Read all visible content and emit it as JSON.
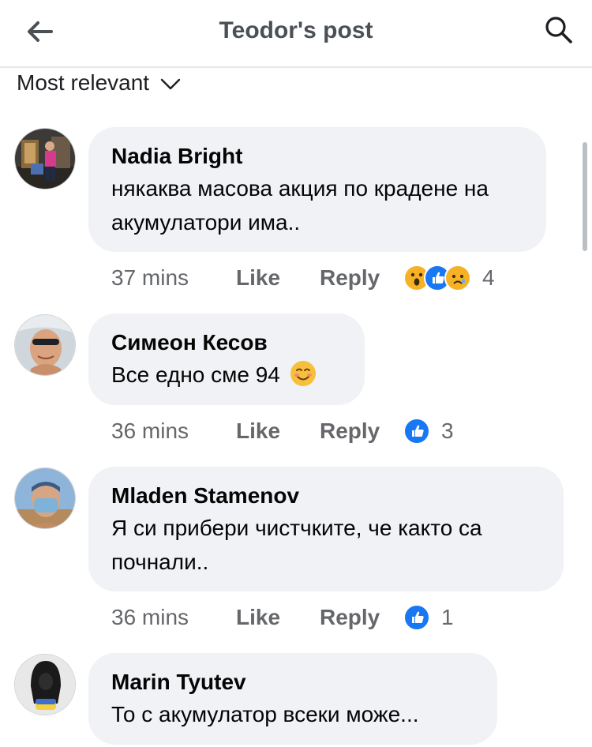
{
  "header": {
    "title": "Teodor's post",
    "back_icon": "arrow-left-icon",
    "search_icon": "search-icon"
  },
  "sort": {
    "label": "Most relevant",
    "icon": "chevron-down-icon"
  },
  "colors": {
    "like_blue": "#1877f2",
    "bubble_bg": "#f0f2f5",
    "meta_gray": "#65676b",
    "wow_yellow": "#f7b125"
  },
  "comments": [
    {
      "author": "Nadia Bright",
      "text": "някаква масова акция по крадене на акумулатори има..",
      "time": "37 mins",
      "like": "Like",
      "reply": "Reply",
      "reactions": [
        "wow",
        "like",
        "sad"
      ],
      "reaction_count": "4"
    },
    {
      "author": "Симеон Кесов",
      "text": "Все едно сме 94",
      "emoji": "smiling-face-icon",
      "time": "36 mins",
      "like": "Like",
      "reply": "Reply",
      "reactions": [
        "like"
      ],
      "reaction_count": "3"
    },
    {
      "author": "Mladen Stamenov",
      "text": "Я си прибери чистчките, че както са почнали..",
      "time": "36 mins",
      "like": "Like",
      "reply": "Reply",
      "reactions": [
        "like"
      ],
      "reaction_count": "1"
    },
    {
      "author": "Marin Tyutev",
      "text": "То с акумулатор всеки може..."
    }
  ]
}
